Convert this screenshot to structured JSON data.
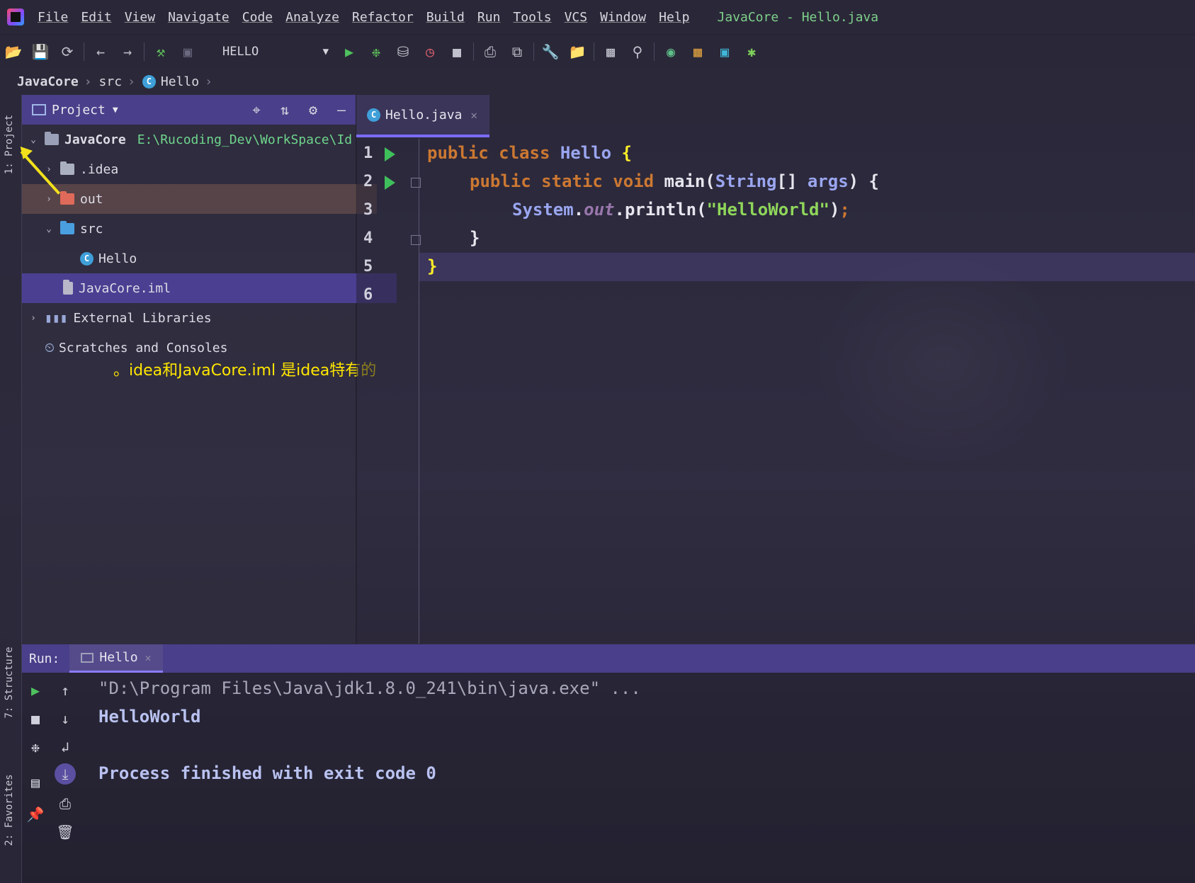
{
  "app": {
    "title": "JavaCore - Hello.java",
    "menu": [
      "File",
      "Edit",
      "View",
      "Navigate",
      "Code",
      "Analyze",
      "Refactor",
      "Build",
      "Run",
      "Tools",
      "VCS",
      "Window",
      "Help"
    ]
  },
  "toolbar": {
    "run_config": "HELLO",
    "icons": [
      "open-icon",
      "save-icon",
      "sync-icon",
      "back-icon",
      "forward-icon",
      "build-hammer-icon",
      "build-module-icon",
      "run-icon",
      "debug-icon",
      "coverage-icon",
      "profile-icon",
      "stop-icon",
      "attach-icon",
      "deploy-icon",
      "settings-wrench-icon",
      "project-structure-icon",
      "terminal-icon",
      "search-icon",
      "vcs-icon",
      "layout-icon",
      "sdk-icon",
      "plugin-icon"
    ]
  },
  "breadcrumb": [
    "JavaCore",
    "src",
    "Hello"
  ],
  "left_strip": {
    "project_tab": "1: Project",
    "structure_tab": "7: Structure",
    "favorites_tab": "2: Favorites"
  },
  "project_panel": {
    "title": "Project",
    "tree": [
      {
        "label": "JavaCore",
        "path": "E:\\Rucoding_Dev\\WorkSpace\\Id",
        "expanded": true
      },
      {
        "label": ".idea",
        "expanded": false
      },
      {
        "label": "out",
        "expanded": false
      },
      {
        "label": "src",
        "expanded": true
      },
      {
        "label": "Hello"
      },
      {
        "label": "JavaCore.iml"
      },
      {
        "label": "External Libraries",
        "expanded": false
      },
      {
        "label": "Scratches and Consoles"
      }
    ],
    "annotation": "。idea和JavaCore.iml 是idea特有的"
  },
  "editor": {
    "tab": "Hello.java",
    "line_numbers": [
      "1",
      "2",
      "3",
      "4",
      "5",
      "6"
    ],
    "code": {
      "l1_kw": "public class ",
      "l1_cls": "Hello ",
      "l1_br": "{",
      "l2_kw": "public static void ",
      "l2_fn": "main(",
      "l2_type": "String",
      "l2_mid": "[] ",
      "l2_arg": "args",
      "l2_end": ") {",
      "l3_cls": "System",
      "l3_dot": ".",
      "l3_fld": "out",
      "l3_call": ".println(",
      "l3_str": "\"HelloWorld\"",
      "l3_close": ")",
      "l3_semi": ";",
      "l4": "}",
      "l5": "}"
    }
  },
  "run_panel": {
    "label": "Run:",
    "tab": "Hello",
    "output": [
      "\"D:\\Program Files\\Java\\jdk1.8.0_241\\bin\\java.exe\" ...",
      "HelloWorld",
      "Process finished with exit code 0"
    ]
  },
  "colors": {
    "accent": "#4a3f8a",
    "keyword": "#cc7832",
    "string": "#8fd65a",
    "brace": "#ffef28",
    "annotation": "#ffe600",
    "path": "#6fd58c"
  }
}
